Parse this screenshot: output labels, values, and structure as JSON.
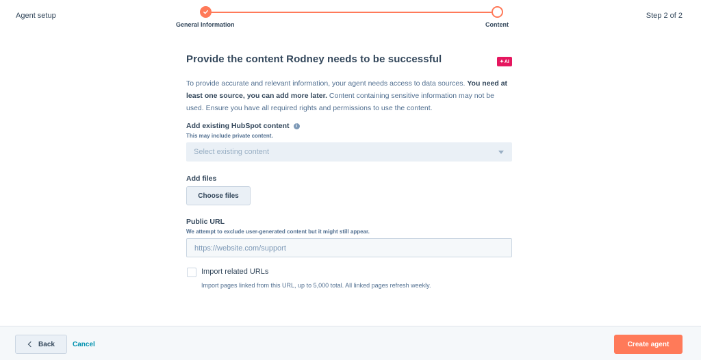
{
  "header": {
    "title": "Agent setup",
    "step_count": "Step 2 of 2",
    "steps": [
      {
        "label": "General Information",
        "state": "complete"
      },
      {
        "label": "Content",
        "state": "active"
      }
    ]
  },
  "main": {
    "title": "Provide the content Rodney needs to be successful",
    "ai_badge": "AI",
    "description_pre": "To provide accurate and relevant information, your agent needs access to data sources. ",
    "description_bold": "You need at least one source, you can add more later.",
    "description_post": " Content containing sensitive information may not be used. Ensure you have all required rights and permissions to use the content.",
    "existing": {
      "label": "Add existing HubSpot content",
      "hint": "This may include private content.",
      "placeholder": "Select existing content"
    },
    "files": {
      "label": "Add files",
      "button": "Choose files"
    },
    "url": {
      "label": "Public URL",
      "hint": "We attempt to exclude user-generated content but it might still appear.",
      "placeholder": "https://website.com/support"
    },
    "import": {
      "label": "Import related URLs",
      "help": "Import pages linked from this URL, up to 5,000 total. All linked pages refresh weekly.",
      "checked": false
    }
  },
  "footer": {
    "back": "Back",
    "cancel": "Cancel",
    "create": "Create agent"
  },
  "colors": {
    "accent": "#ff7a59",
    "ai_badge": "#e5175f",
    "link": "#0091ae"
  }
}
